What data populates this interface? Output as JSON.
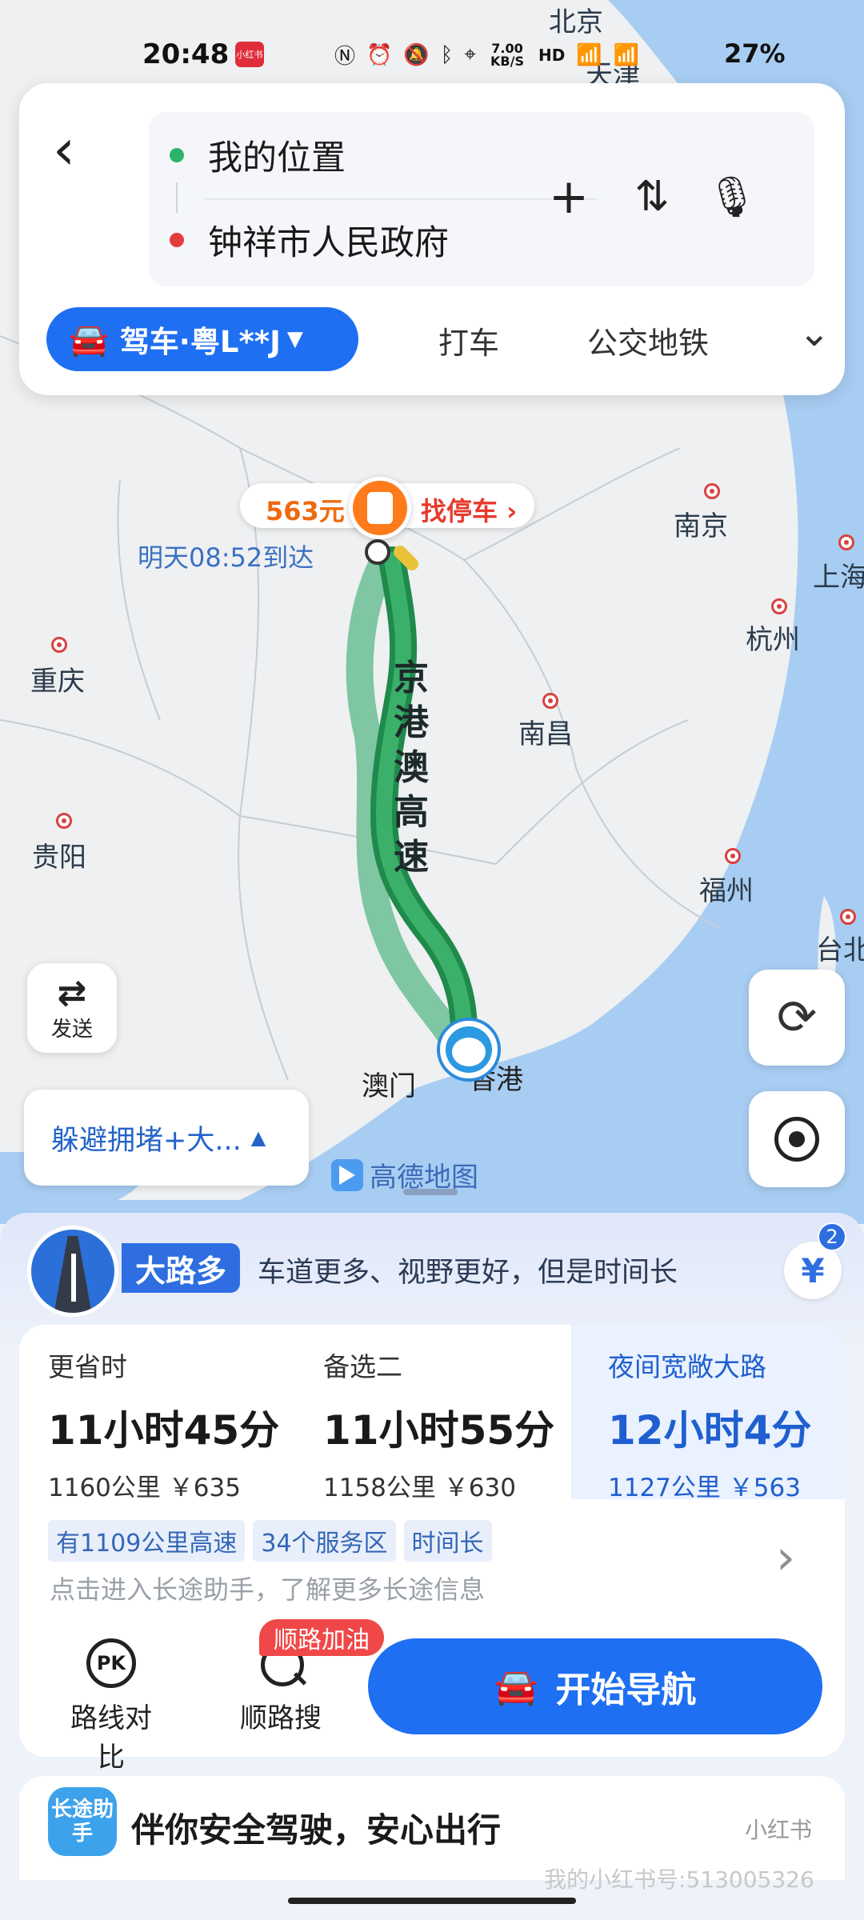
{
  "status_bar": {
    "time": "20:48",
    "app_tag": "小红书",
    "net_speed": "7.00 KB/S",
    "battery": "27%"
  },
  "search": {
    "origin": "我的位置",
    "destination": "钟祥市人民政府"
  },
  "mode_tabs": {
    "active": "驾车·粤L**J",
    "taxi": "打车",
    "transit": "公交地铁"
  },
  "map": {
    "cities": [
      {
        "name": "北京"
      },
      {
        "name": "天津"
      },
      {
        "name": "南京"
      },
      {
        "name": "上海"
      },
      {
        "name": "杭州"
      },
      {
        "name": "重庆"
      },
      {
        "name": "南昌"
      },
      {
        "name": "贵阳"
      },
      {
        "name": "福州"
      },
      {
        "name": "台北"
      },
      {
        "name": "澳门"
      },
      {
        "name": "香港"
      }
    ],
    "parking_price": "563元",
    "parking_label": "找停车",
    "arrive_text": "明天08:52到达",
    "road_name": "京港澳高速",
    "send_label": "发送",
    "avoid_label": "躲避拥堵+大...",
    "logo": "高德地图",
    "colors": {
      "route_main": "#1f8a4c",
      "route_alt": "#4bb37a",
      "accent": "#1f6ff2"
    }
  },
  "banner": {
    "tag": "大路多",
    "desc": "车道更多、视野更好，但是时间长",
    "badge": "2",
    "yen": "¥"
  },
  "routes": [
    {
      "name": "更省时",
      "duration": "11小时45分",
      "sub": "1160公里 ￥635"
    },
    {
      "name": "备选二",
      "duration": "11小时55分",
      "sub": "1158公里 ￥630"
    },
    {
      "name": "夜间宽敞大路",
      "duration": "12小时4分",
      "sub": "1127公里 ￥563"
    }
  ],
  "tags": [
    "有1109公里高速",
    "34个服务区",
    "时间长"
  ],
  "hint": "点击进入长途助手，了解更多长途信息",
  "actions": {
    "compare": "路线对比",
    "pk": "PK",
    "search": "顺路搜",
    "gas_badge": "顺路加油",
    "start": "开始导航"
  },
  "safe": {
    "icon": "长途助手",
    "text": "伴你安全驾驶，安心出行"
  },
  "watermark": "我的小红书号:513005326",
  "xhs_mark": "小红书"
}
